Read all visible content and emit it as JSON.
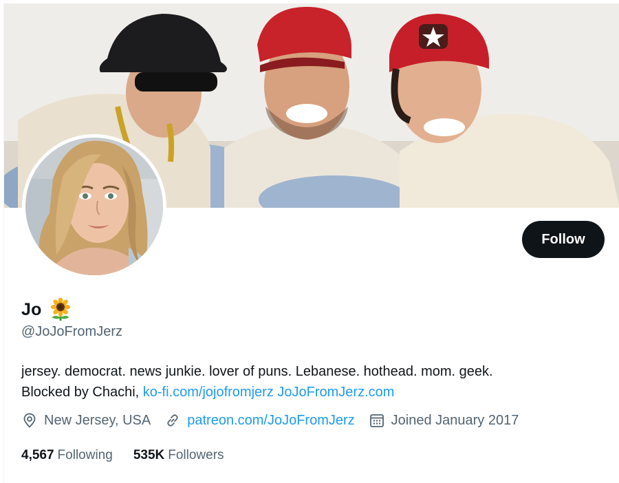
{
  "profile": {
    "display_name": "Jo",
    "name_emoji": "sunflower-icon",
    "handle": "@JoJoFromJerz",
    "follow_label": "Follow",
    "bio": {
      "line1": "jersey. democrat. news junkie. lover of puns. Lebanese. hothead. mom. geek.",
      "line2_text": "Blocked by Chachi, ",
      "link1": "ko-fi.com/jojofromjerz",
      "link2": "JoJoFromJerz.com"
    },
    "location": "New Jersey, USA",
    "website": "patreon.com/JoJoFromJerz",
    "joined": "Joined January 2017",
    "stats": {
      "following_count": "4,567",
      "following_label": "Following",
      "followers_count": "535K",
      "followers_label": "Followers"
    }
  },
  "icons": {
    "location": "location-pin-icon",
    "link": "link-icon",
    "calendar": "calendar-icon"
  },
  "colors": {
    "accent": "#1d9bf0",
    "text_primary": "#0f1419",
    "text_secondary": "#536471",
    "button_bg": "#0f1419"
  }
}
